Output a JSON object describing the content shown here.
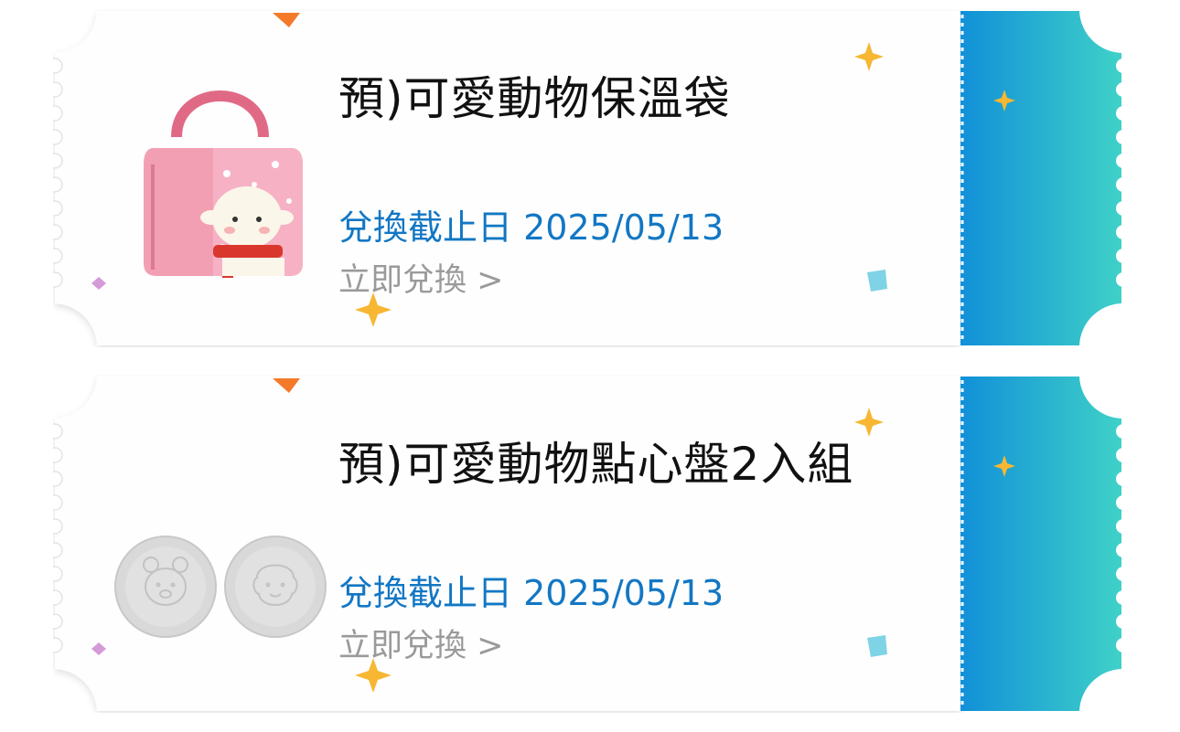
{
  "coupons": [
    {
      "title": "預)可愛動物保溫袋",
      "deadline_label": "兌換截止日",
      "deadline_date": "2025/05/13",
      "redeem_label": "立即兌換 >",
      "image_icon": "lunch-bag-sheep-image"
    },
    {
      "title": "預)可愛動物點心盤2入組",
      "deadline_label": "兌換截止日",
      "deadline_date": "2025/05/13",
      "redeem_label": "立即兌換 >",
      "image_icon": "snack-plates-image"
    }
  ],
  "colors": {
    "accent_blue": "#1277c4",
    "stub_gradient_start": "#1190d8",
    "stub_gradient_end": "#3fd1c8",
    "star_yellow": "#f7b733",
    "confetti_orange": "#f47a2a"
  }
}
